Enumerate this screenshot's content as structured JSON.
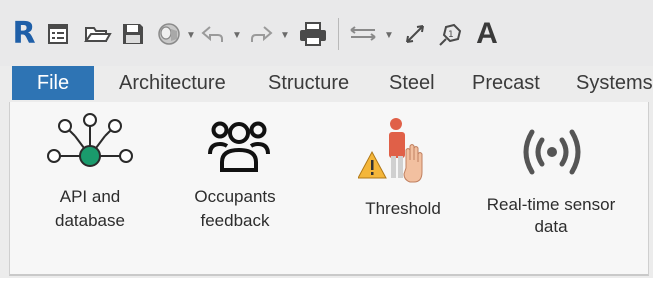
{
  "quick_access": {
    "app_logo": "R",
    "tools": [
      "revit-logo",
      "properties-icon",
      "open-icon",
      "save-icon",
      "sync-icon",
      "undo-icon",
      "redo-icon",
      "print-icon",
      "measure-icon",
      "dimension-icon",
      "tag-icon",
      "text-icon"
    ],
    "text_tool_glyph": "A"
  },
  "tabs": [
    {
      "label": "File"
    },
    {
      "label": "Architecture"
    },
    {
      "label": "Structure"
    },
    {
      "label": "Steel"
    },
    {
      "label": "Precast"
    },
    {
      "label": "Systems"
    }
  ],
  "ribbon": {
    "tools": [
      {
        "line1": "API and",
        "line2": "database"
      },
      {
        "line1": "Occupants",
        "line2": "feedback"
      },
      {
        "line1": "Threshold",
        "line2": ""
      },
      {
        "line1": "Real-time sensor",
        "line2": "data"
      }
    ]
  },
  "colors": {
    "accent": "#2e74b4",
    "api_green": "#1a9a6c",
    "revit_blue": "#1f5fa8"
  }
}
